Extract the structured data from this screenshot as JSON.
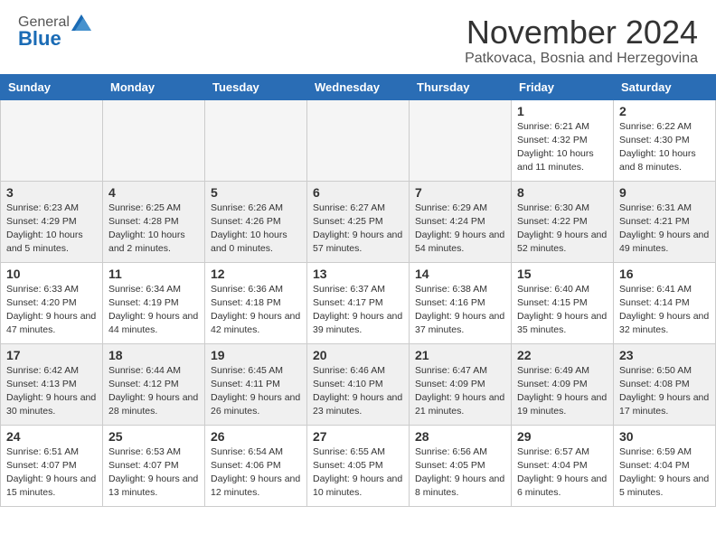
{
  "header": {
    "logo_general": "General",
    "logo_blue": "Blue",
    "month_title": "November 2024",
    "location": "Patkovaca, Bosnia and Herzegovina"
  },
  "weekdays": [
    "Sunday",
    "Monday",
    "Tuesday",
    "Wednesday",
    "Thursday",
    "Friday",
    "Saturday"
  ],
  "weeks": [
    [
      {
        "day": "",
        "info": ""
      },
      {
        "day": "",
        "info": ""
      },
      {
        "day": "",
        "info": ""
      },
      {
        "day": "",
        "info": ""
      },
      {
        "day": "",
        "info": ""
      },
      {
        "day": "1",
        "info": "Sunrise: 6:21 AM\nSunset: 4:32 PM\nDaylight: 10 hours and 11 minutes."
      },
      {
        "day": "2",
        "info": "Sunrise: 6:22 AM\nSunset: 4:30 PM\nDaylight: 10 hours and 8 minutes."
      }
    ],
    [
      {
        "day": "3",
        "info": "Sunrise: 6:23 AM\nSunset: 4:29 PM\nDaylight: 10 hours and 5 minutes."
      },
      {
        "day": "4",
        "info": "Sunrise: 6:25 AM\nSunset: 4:28 PM\nDaylight: 10 hours and 2 minutes."
      },
      {
        "day": "5",
        "info": "Sunrise: 6:26 AM\nSunset: 4:26 PM\nDaylight: 10 hours and 0 minutes."
      },
      {
        "day": "6",
        "info": "Sunrise: 6:27 AM\nSunset: 4:25 PM\nDaylight: 9 hours and 57 minutes."
      },
      {
        "day": "7",
        "info": "Sunrise: 6:29 AM\nSunset: 4:24 PM\nDaylight: 9 hours and 54 minutes."
      },
      {
        "day": "8",
        "info": "Sunrise: 6:30 AM\nSunset: 4:22 PM\nDaylight: 9 hours and 52 minutes."
      },
      {
        "day": "9",
        "info": "Sunrise: 6:31 AM\nSunset: 4:21 PM\nDaylight: 9 hours and 49 minutes."
      }
    ],
    [
      {
        "day": "10",
        "info": "Sunrise: 6:33 AM\nSunset: 4:20 PM\nDaylight: 9 hours and 47 minutes."
      },
      {
        "day": "11",
        "info": "Sunrise: 6:34 AM\nSunset: 4:19 PM\nDaylight: 9 hours and 44 minutes."
      },
      {
        "day": "12",
        "info": "Sunrise: 6:36 AM\nSunset: 4:18 PM\nDaylight: 9 hours and 42 minutes."
      },
      {
        "day": "13",
        "info": "Sunrise: 6:37 AM\nSunset: 4:17 PM\nDaylight: 9 hours and 39 minutes."
      },
      {
        "day": "14",
        "info": "Sunrise: 6:38 AM\nSunset: 4:16 PM\nDaylight: 9 hours and 37 minutes."
      },
      {
        "day": "15",
        "info": "Sunrise: 6:40 AM\nSunset: 4:15 PM\nDaylight: 9 hours and 35 minutes."
      },
      {
        "day": "16",
        "info": "Sunrise: 6:41 AM\nSunset: 4:14 PM\nDaylight: 9 hours and 32 minutes."
      }
    ],
    [
      {
        "day": "17",
        "info": "Sunrise: 6:42 AM\nSunset: 4:13 PM\nDaylight: 9 hours and 30 minutes."
      },
      {
        "day": "18",
        "info": "Sunrise: 6:44 AM\nSunset: 4:12 PM\nDaylight: 9 hours and 28 minutes."
      },
      {
        "day": "19",
        "info": "Sunrise: 6:45 AM\nSunset: 4:11 PM\nDaylight: 9 hours and 26 minutes."
      },
      {
        "day": "20",
        "info": "Sunrise: 6:46 AM\nSunset: 4:10 PM\nDaylight: 9 hours and 23 minutes."
      },
      {
        "day": "21",
        "info": "Sunrise: 6:47 AM\nSunset: 4:09 PM\nDaylight: 9 hours and 21 minutes."
      },
      {
        "day": "22",
        "info": "Sunrise: 6:49 AM\nSunset: 4:09 PM\nDaylight: 9 hours and 19 minutes."
      },
      {
        "day": "23",
        "info": "Sunrise: 6:50 AM\nSunset: 4:08 PM\nDaylight: 9 hours and 17 minutes."
      }
    ],
    [
      {
        "day": "24",
        "info": "Sunrise: 6:51 AM\nSunset: 4:07 PM\nDaylight: 9 hours and 15 minutes."
      },
      {
        "day": "25",
        "info": "Sunrise: 6:53 AM\nSunset: 4:07 PM\nDaylight: 9 hours and 13 minutes."
      },
      {
        "day": "26",
        "info": "Sunrise: 6:54 AM\nSunset: 4:06 PM\nDaylight: 9 hours and 12 minutes."
      },
      {
        "day": "27",
        "info": "Sunrise: 6:55 AM\nSunset: 4:05 PM\nDaylight: 9 hours and 10 minutes."
      },
      {
        "day": "28",
        "info": "Sunrise: 6:56 AM\nSunset: 4:05 PM\nDaylight: 9 hours and 8 minutes."
      },
      {
        "day": "29",
        "info": "Sunrise: 6:57 AM\nSunset: 4:04 PM\nDaylight: 9 hours and 6 minutes."
      },
      {
        "day": "30",
        "info": "Sunrise: 6:59 AM\nSunset: 4:04 PM\nDaylight: 9 hours and 5 minutes."
      }
    ]
  ]
}
